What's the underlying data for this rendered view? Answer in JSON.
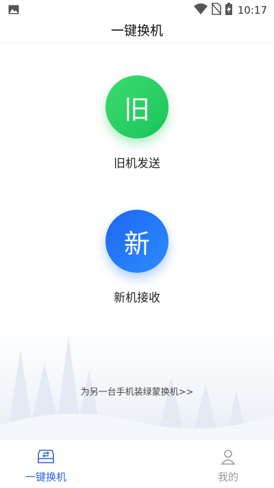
{
  "status_bar": {
    "time": "10:17",
    "icons": [
      "gallery-icon",
      "wifi-icon",
      "no-sim-icon",
      "battery-charging-icon"
    ]
  },
  "header": {
    "title": "一键换机"
  },
  "actions": [
    {
      "circle_text": "旧",
      "label": "旧机发送",
      "color": "#22cc62",
      "icon": "old-phone-icon"
    },
    {
      "circle_text": "新",
      "label": "新机接收",
      "color": "#1f74f4",
      "icon": "new-phone-icon"
    }
  ],
  "footer_link": "为另一台手机装绿蒙换机>>",
  "tabs": [
    {
      "label": "一键换机",
      "icon": "transfer-box-icon",
      "active": true,
      "color": "#2a62e6"
    },
    {
      "label": "我的",
      "icon": "user-icon",
      "active": false,
      "color": "#999999"
    }
  ]
}
